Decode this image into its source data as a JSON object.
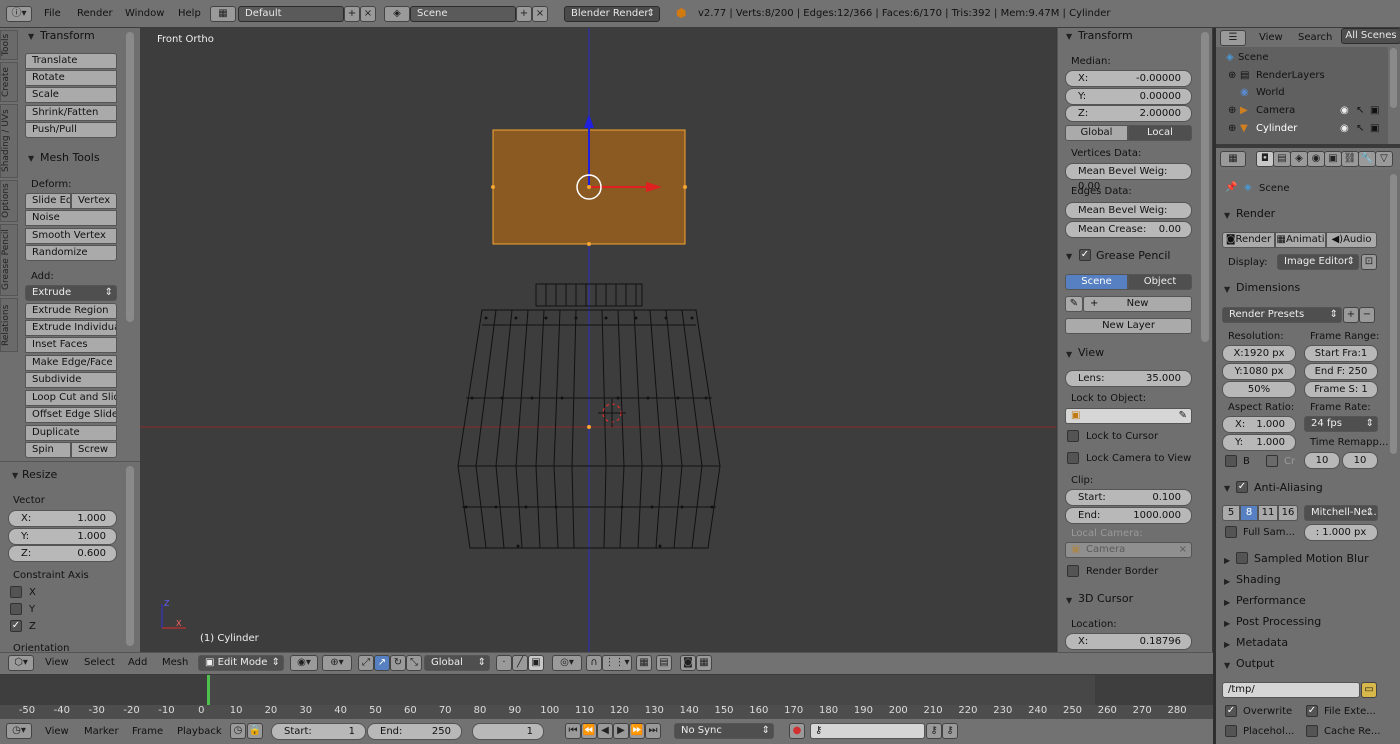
{
  "top_header": {
    "menus": [
      "File",
      "Render",
      "Window",
      "Help"
    ],
    "layout": "Default",
    "scene": "Scene",
    "engine": "Blender Render",
    "stats": "v2.77 | Verts:8/200 | Edges:12/366 | Faces:6/170 | Tris:392 | Mem:9.47M | Cylinder"
  },
  "left_tabs": [
    "Tools",
    "Create",
    "Shading / UVs",
    "Options",
    "Grease Pencil",
    "Relations"
  ],
  "tools": {
    "transform_title": "Transform",
    "transform_buttons": [
      "Translate",
      "Rotate",
      "Scale",
      "Shrink/Fatten",
      "Push/Pull"
    ],
    "mesh_tools_title": "Mesh Tools",
    "deform_label": "Deform:",
    "slide_edge": "Slide Ed",
    "vertex": "Vertex",
    "deform_buttons": [
      "Noise",
      "Smooth Vertex",
      "Randomize"
    ],
    "add_label": "Add:",
    "extrude": "Extrude",
    "add_buttons": [
      "Extrude Region",
      "Extrude Individual",
      "Inset Faces",
      "Make Edge/Face",
      "Subdivide",
      "Loop Cut and Slide",
      "Offset Edge Slide",
      "Duplicate"
    ],
    "spin": "Spin",
    "screw": "Screw"
  },
  "operator": {
    "title": "Resize",
    "vector_label": "Vector",
    "x_label": "X:",
    "x": "1.000",
    "y_label": "Y:",
    "y": "1.000",
    "z_label": "Z:",
    "z": "0.600",
    "constraint_label": "Constraint Axis",
    "axes": [
      "X",
      "Y",
      "Z"
    ],
    "axes_checked": [
      false,
      false,
      true
    ],
    "orientation_label": "Orientation"
  },
  "viewport": {
    "view_name": "Front Ortho",
    "object_label": "(1) Cylinder"
  },
  "properties_n": {
    "transform_title": "Transform",
    "median_label": "Median:",
    "x_label": "X:",
    "x": "-0.00000",
    "y_label": "Y:",
    "y": "0.00000",
    "z_label": "Z:",
    "z": "2.00000",
    "global": "Global",
    "local": "Local",
    "vertices_data": "Vertices Data:",
    "mean_bevel_1": "Mean Bevel Weig: 0.00",
    "edges_data": "Edges Data:",
    "mean_bevel_2": "Mean Bevel Weig: 0.00",
    "mean_crease_label": "Mean Crease:",
    "mean_crease": "0.00",
    "grease_title": "Grease Pencil",
    "gp_scene": "Scene",
    "gp_object": "Object",
    "gp_new": "New",
    "gp_new_layer": "New Layer",
    "view_title": "View",
    "lens_label": "Lens:",
    "lens": "35.000",
    "lock_object": "Lock to Object:",
    "lock_cursor": "Lock to Cursor",
    "lock_camera": "Lock Camera to View",
    "clip_label": "Clip:",
    "clip_start_label": "Start:",
    "clip_start": "0.100",
    "clip_end_label": "End:",
    "clip_end": "1000.000",
    "local_camera": "Local Camera:",
    "camera": "Camera",
    "render_border": "Render Border",
    "cursor_title": "3D Cursor",
    "location_label": "Location:",
    "cursor_x_label": "X:",
    "cursor_x": "0.18796"
  },
  "outliner": {
    "view": "View",
    "search": "Search",
    "all_scenes": "All Scenes",
    "items": [
      "Scene",
      "RenderLayers",
      "World",
      "Camera",
      "Cylinder"
    ]
  },
  "render_props": {
    "scene": "Scene",
    "render_title": "Render",
    "render_btn": "Render",
    "anim_btn": "Animati",
    "audio_btn": "Audio",
    "display_label": "Display:",
    "display_value": "Image Editor",
    "dimensions_title": "Dimensions",
    "presets": "Render Presets",
    "resolution_label": "Resolution:",
    "res_x": "X:1920 px",
    "res_y": "Y:1080 px",
    "res_pct": "50%",
    "frame_range_label": "Frame Range:",
    "start_frame": "Start Fra:1",
    "end_frame": "End F: 250",
    "frame_step": "Frame S: 1",
    "aspect_label": "Aspect Ratio:",
    "aspect_x_label": "X:",
    "aspect_x": "1.000",
    "aspect_y_label": "Y:",
    "aspect_y": "1.000",
    "frame_rate_label": "Frame Rate:",
    "fps": "24 fps",
    "time_remap_label": "Time Remapp...",
    "remap_old": "10",
    "remap_new": "10",
    "border_b": "B",
    "border_cr": "Cr",
    "aa_title": "Anti-Aliasing",
    "aa_samples": [
      "5",
      "8",
      "11",
      "16"
    ],
    "aa_filter": "Mitchell-Ne...",
    "full_sample": "Full Sam...",
    "filter_size": ": 1.000 px",
    "motion_blur": "Sampled Motion Blur",
    "shading": "Shading",
    "performance": "Performance",
    "post_processing": "Post Processing",
    "metadata": "Metadata",
    "output_title": "Output",
    "output_path": "/tmp/",
    "overwrite": "Overwrite",
    "file_ext": "File Exte...",
    "placeholder": "Placehol...",
    "cache": "Cache Re..."
  },
  "view3d_header": {
    "menus": [
      "View",
      "Select",
      "Add",
      "Mesh"
    ],
    "mode": "Edit Mode",
    "orientation": "Global"
  },
  "ruler_ticks": [
    "-50",
    "-40",
    "-30",
    "-20",
    "-10",
    "0",
    "10",
    "20",
    "30",
    "40",
    "50",
    "60",
    "70",
    "80",
    "90",
    "100",
    "110",
    "120",
    "130",
    "140",
    "150",
    "160",
    "170",
    "180",
    "190",
    "200",
    "210",
    "220",
    "230",
    "240",
    "250",
    "260",
    "270",
    "280"
  ],
  "playback": {
    "menus": [
      "View",
      "Marker",
      "Frame",
      "Playback"
    ],
    "start_label": "Start:",
    "start": "1",
    "end_label": "End:",
    "end": "250",
    "current": "1",
    "sync": "No Sync"
  },
  "colors": {
    "selection": "#f5a431",
    "selection_fill": "#8a5a22",
    "x_axis": "#d03a3a",
    "z_axis": "#3030d8",
    "panel": "#727272",
    "viewport_bg": "#3d3d3d",
    "active_blue": "#5680c2"
  }
}
